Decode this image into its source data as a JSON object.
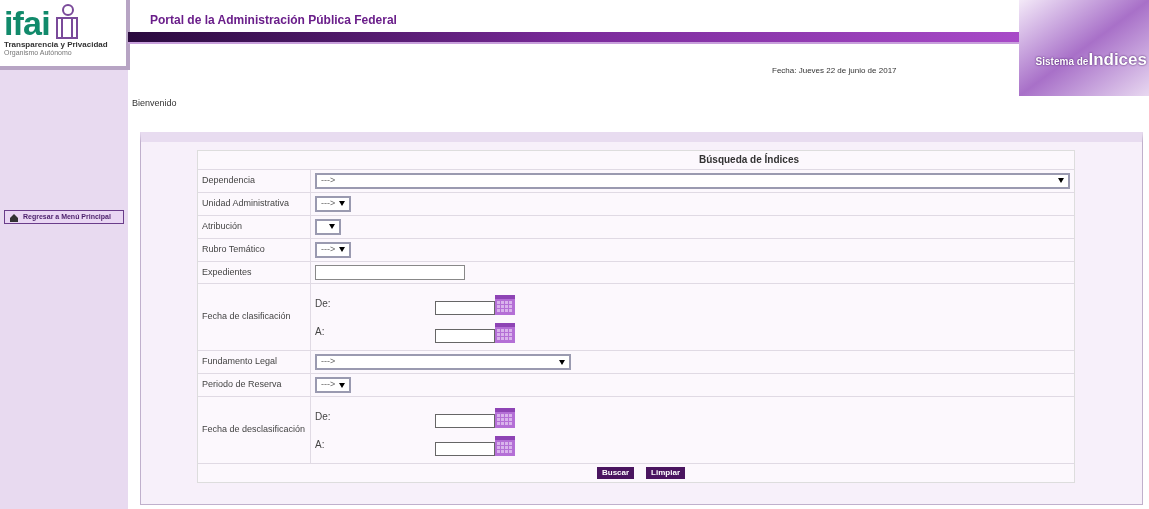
{
  "logo": {
    "letters": "ifai",
    "tagline": "Transparencia y Privacidad",
    "subtitle": "Organismo Autónomo"
  },
  "header": {
    "title": "Portal de la Administración Pública Federal",
    "banner_small": "Sistema de",
    "banner_large": "Indices",
    "date": "Fecha: Jueves 22 de junio de 2017"
  },
  "welcome": "Bienvenido",
  "sidebar": {
    "button": "Regresar a Menú Principal"
  },
  "form": {
    "title": "Búsqueda de Índices",
    "rows": [
      {
        "label": "Dependencia",
        "kind": "wideselect",
        "value": "--->"
      },
      {
        "label": "Unidad Administrativa",
        "kind": "select",
        "value": "--->"
      },
      {
        "label": "Atribución",
        "kind": "select"
      },
      {
        "label": "Rubro Temático",
        "kind": "select",
        "value": "--->"
      },
      {
        "label": "Expedientes",
        "kind": "text"
      },
      {
        "label": "Fecha de clasificación",
        "kind": "daterange",
        "from": "De:",
        "to": "A:"
      },
      {
        "label": "Fundamento Legal",
        "kind": "midselect",
        "value": "--->"
      },
      {
        "label": "Periodo de Reserva",
        "kind": "select",
        "value": "--->"
      },
      {
        "label": "Fecha de desclasificación",
        "kind": "daterange",
        "from": "De:",
        "to": "A:"
      }
    ],
    "buttons": [
      "Buscar",
      "Limpiar"
    ]
  }
}
